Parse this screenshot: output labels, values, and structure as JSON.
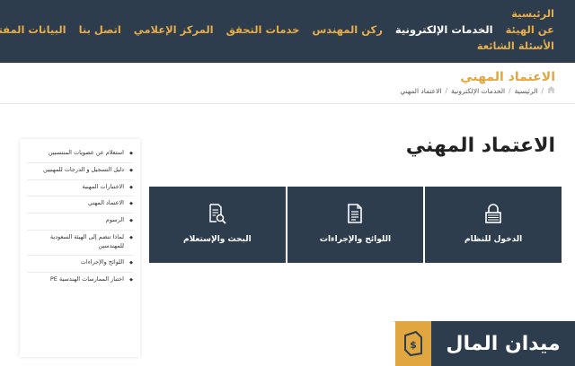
{
  "nav": {
    "row1": [
      "الرئيسية"
    ],
    "row2": [
      "عن الهيئة",
      "الخدمات الإلكترونية",
      "ركن المهندس",
      "خدمات التحقق",
      "المركز الإعلامي",
      "اتصل بنا",
      "البيانات المفتوحة"
    ],
    "row3": [
      "الأسئلة الشائعة"
    ]
  },
  "header": {
    "title": "الاعتماد المهني",
    "breadcrumb": [
      "الرئيسية",
      "الخدمات الإلكترونية",
      "الاعتماد المهني"
    ]
  },
  "main": {
    "title": "الاعتماد المهني",
    "tiles": [
      {
        "label": "الدخول للنظام",
        "icon": "lock-icon"
      },
      {
        "label": "اللوائح والإجراءات",
        "icon": "document-icon"
      },
      {
        "label": "البحث والإستعلام",
        "icon": "search-document-icon"
      }
    ]
  },
  "sidebar": {
    "items": [
      "استعلام عن عضويات المنتسبين",
      "دليل التسجيل و الدرجات للمهنيين",
      "الاختبارات المهنية",
      "الاعتماد المهني",
      "الرسوم",
      "لماذا تنضم إلى الهيئة السعودية للمهندسين",
      "اللوائح والإجراءات",
      "اختبار الممارسات الهندسية PE"
    ]
  },
  "watermark": {
    "text": "ميدان المال"
  },
  "colors": {
    "nav_bg": "#2d3d4e",
    "accent": "#e0a640",
    "tile_bg": "#2d3d4e"
  }
}
